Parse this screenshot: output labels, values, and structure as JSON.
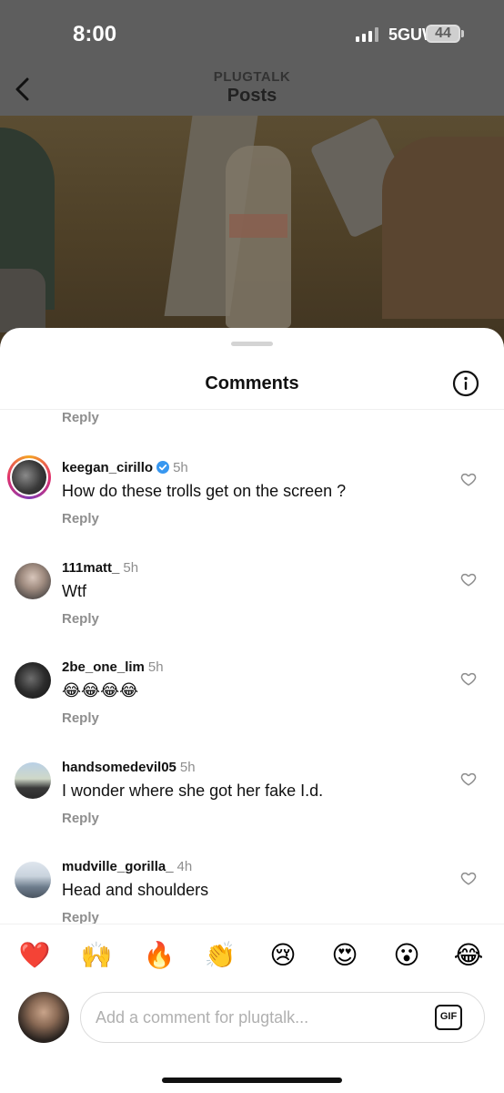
{
  "status_bar": {
    "time": "8:00",
    "network": "5GUW",
    "battery": "44"
  },
  "header": {
    "account": "PLUGTALK",
    "title": "Posts"
  },
  "sheet": {
    "title": "Comments"
  },
  "top_reply_label": "Reply",
  "comments": [
    {
      "username": "keegan_cirillo",
      "verified": true,
      "time": "5h",
      "text": "How do these trolls get on the screen ?",
      "reply": "Reply"
    },
    {
      "username": "111matt_",
      "verified": false,
      "time": "5h",
      "text": "Wtf",
      "reply": "Reply"
    },
    {
      "username": "2be_one_lim",
      "verified": false,
      "time": "5h",
      "text": "😂😂😂😂",
      "reply": "Reply"
    },
    {
      "username": "handsomedevil05",
      "verified": false,
      "time": "5h",
      "text": "I wonder where she got her fake I.d.",
      "reply": "Reply"
    },
    {
      "username": "mudville_gorilla_",
      "verified": false,
      "time": "4h",
      "text": "Head and shoulders",
      "reply": "Reply"
    }
  ],
  "emoji_bar": [
    "❤️",
    "🙌",
    "🔥",
    "👏",
    "😢",
    "😍",
    "😮",
    "😂"
  ],
  "composer": {
    "placeholder": "Add a comment for plugtalk...",
    "gif_label": "GIF"
  },
  "colors": {
    "verified": "#3897f0",
    "muted": "#8e8e8e"
  }
}
